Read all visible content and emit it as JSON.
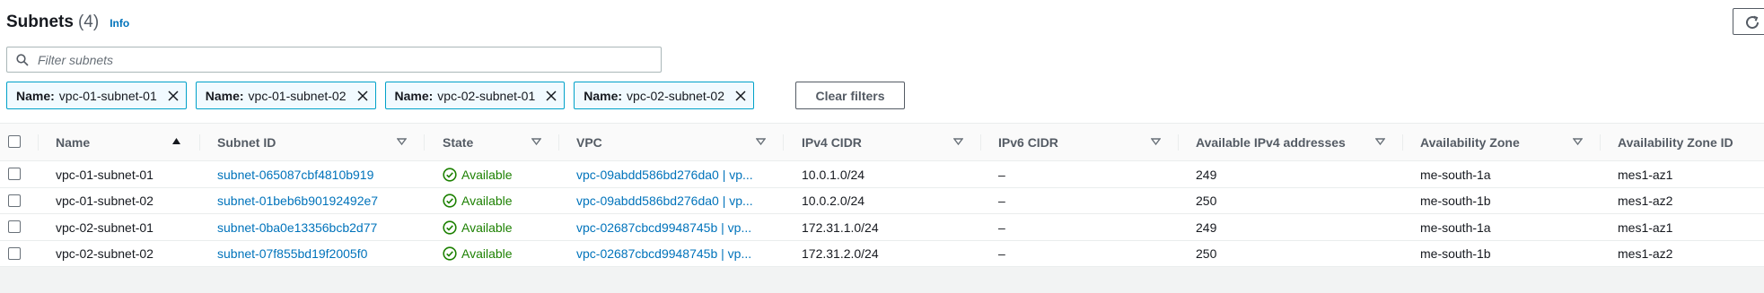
{
  "header": {
    "title": "Subnets",
    "count": "(4)",
    "info": "Info"
  },
  "toolbar": {
    "refresh_icon": "refresh-icon"
  },
  "filter": {
    "placeholder": "Filter subnets",
    "value": ""
  },
  "tokens": [
    {
      "key": "Name:",
      "value": "vpc-01-subnet-01"
    },
    {
      "key": "Name:",
      "value": "vpc-01-subnet-02"
    },
    {
      "key": "Name:",
      "value": "vpc-02-subnet-01"
    },
    {
      "key": "Name:",
      "value": "vpc-02-subnet-02"
    }
  ],
  "clear_filters": "Clear filters",
  "columns": [
    "Name",
    "Subnet ID",
    "State",
    "VPC",
    "IPv4 CIDR",
    "IPv6 CIDR",
    "Available IPv4 addresses",
    "Availability Zone",
    "Availability Zone ID"
  ],
  "rows": [
    {
      "name": "vpc-01-subnet-01",
      "subnet_id": "subnet-065087cbf4810b919",
      "state": "Available",
      "vpc": "vpc-09abdd586bd276da0 | vp...",
      "ipv4": "10.0.1.0/24",
      "ipv6": "–",
      "available": "249",
      "az": "me-south-1a",
      "az_id": "mes1-az1"
    },
    {
      "name": "vpc-01-subnet-02",
      "subnet_id": "subnet-01beb6b90192492e7",
      "state": "Available",
      "vpc": "vpc-09abdd586bd276da0 | vp...",
      "ipv4": "10.0.2.0/24",
      "ipv6": "–",
      "available": "250",
      "az": "me-south-1b",
      "az_id": "mes1-az2"
    },
    {
      "name": "vpc-02-subnet-01",
      "subnet_id": "subnet-0ba0e13356bcb2d77",
      "state": "Available",
      "vpc": "vpc-02687cbcd9948745b | vp...",
      "ipv4": "172.31.1.0/24",
      "ipv6": "–",
      "available": "249",
      "az": "me-south-1a",
      "az_id": "mes1-az1"
    },
    {
      "name": "vpc-02-subnet-02",
      "subnet_id": "subnet-07f855bd19f2005f0",
      "state": "Available",
      "vpc": "vpc-02687cbcd9948745b | vp...",
      "ipv4": "172.31.2.0/24",
      "ipv6": "–",
      "available": "250",
      "az": "me-south-1b",
      "az_id": "mes1-az2"
    }
  ],
  "colors": {
    "link": "#0073bb",
    "available": "#1d8102",
    "token_border": "#00a1c9",
    "token_bg": "#f1faff"
  }
}
